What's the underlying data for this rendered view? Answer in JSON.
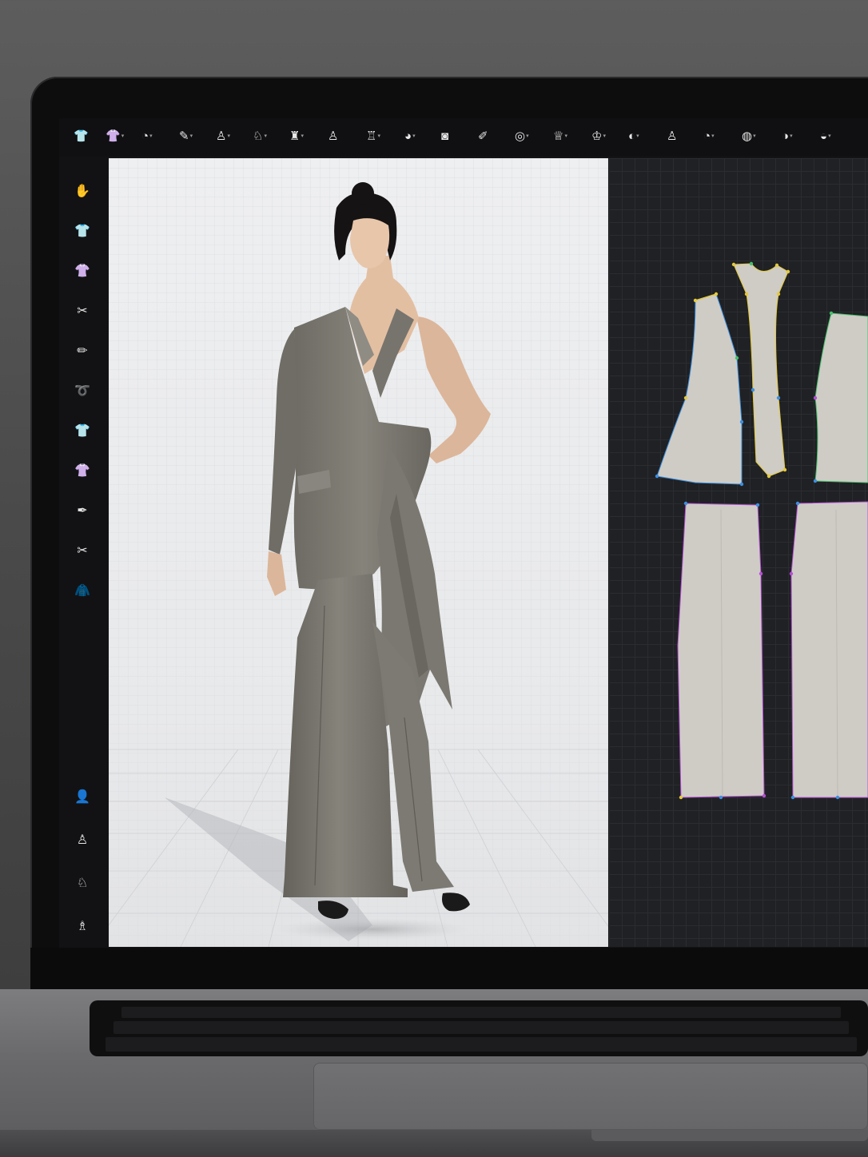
{
  "window": {
    "app": "3D garment design software"
  },
  "toolbar": {
    "tools": [
      {
        "icon": "shirt-logo-icon",
        "glyph": "👕",
        "caret": false
      },
      {
        "icon": "tshirt-tool-icon",
        "glyph": "👚",
        "caret": true
      },
      {
        "icon": "round-tool-icon",
        "glyph": "◔",
        "caret": true
      },
      {
        "icon": "pen-tool-icon",
        "glyph": "✎",
        "caret": true
      },
      {
        "icon": "person-tool-icon",
        "glyph": "♙",
        "caret": true
      },
      {
        "icon": "figure-tool-icon",
        "glyph": "♘",
        "caret": true
      },
      {
        "icon": "garment-tool-icon",
        "glyph": "♜",
        "caret": true
      },
      {
        "icon": "avatar-tool-icon",
        "glyph": "♙",
        "caret": false
      },
      {
        "icon": "jacket-tool-icon",
        "glyph": "♖",
        "caret": true
      },
      {
        "icon": "search-tool-icon",
        "glyph": "◕",
        "caret": true
      },
      {
        "icon": "measure-tool-icon",
        "glyph": "◙",
        "caret": false
      },
      {
        "icon": "edit-tool-icon",
        "glyph": "✐",
        "caret": false
      },
      {
        "icon": "sew-tool-icon",
        "glyph": "◎",
        "caret": true
      },
      {
        "icon": "fold-tool-icon",
        "glyph": "♕",
        "caret": true
      },
      {
        "icon": "pin-tool-icon",
        "glyph": "♔",
        "caret": true
      },
      {
        "icon": "sim-tool-icon",
        "glyph": "◐",
        "caret": true
      },
      {
        "icon": "fabric-tool-icon",
        "glyph": "♙",
        "caret": false
      },
      {
        "icon": "zoom-tool-icon",
        "glyph": "◔",
        "caret": true
      },
      {
        "icon": "camera-tool-icon",
        "glyph": "◍",
        "caret": true
      },
      {
        "icon": "render-tool-icon",
        "glyph": "◑",
        "caret": true
      },
      {
        "icon": "export-tool-icon",
        "glyph": "◒",
        "caret": true
      }
    ]
  },
  "sidebar": {
    "top": [
      {
        "icon": "select-mesh-icon",
        "glyph": "✋"
      },
      {
        "icon": "shirt-front-icon",
        "glyph": "👕"
      },
      {
        "icon": "shirt-back-icon",
        "glyph": "👚"
      },
      {
        "icon": "needle-icon",
        "glyph": "✂"
      },
      {
        "icon": "pencil-icon",
        "glyph": "✏"
      },
      {
        "icon": "tape-icon",
        "glyph": "➰"
      },
      {
        "icon": "tshirt-icon",
        "glyph": "👕"
      },
      {
        "icon": "tshirt-pleat-icon",
        "glyph": "👚"
      },
      {
        "icon": "brush-icon",
        "glyph": "✒"
      },
      {
        "icon": "pin-needle-icon",
        "glyph": "✂"
      },
      {
        "icon": "jacket-icon",
        "glyph": "🧥"
      }
    ],
    "bottom": [
      {
        "icon": "avatar-icon",
        "glyph": "👤"
      },
      {
        "icon": "avatar-pose-icon",
        "glyph": "♙"
      },
      {
        "icon": "avatar-measure-icon",
        "glyph": "♘"
      },
      {
        "icon": "avatar-dress-icon",
        "glyph": "♗"
      }
    ]
  },
  "colors": {
    "fabric": "#7d7a73",
    "fabric_dark": "#5f5c56",
    "fabric_light": "#8e8b83",
    "skin": "#e6c3a6",
    "hair": "#141212",
    "pattern_piece": "#cfccc6",
    "seam_blue": "#3b8fe0",
    "seam_yellow": "#e4c93a",
    "seam_purple": "#b64fd6",
    "seam_green": "#44c06a"
  }
}
